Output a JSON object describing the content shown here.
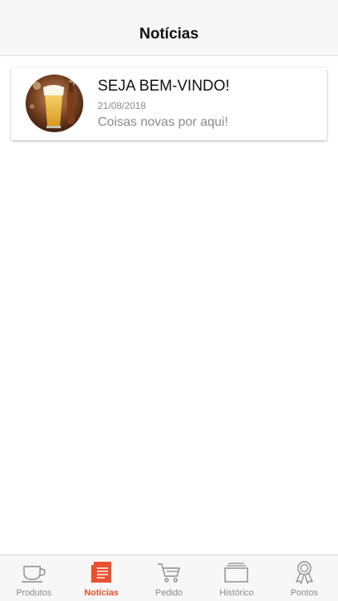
{
  "header": {
    "title": "Notícias"
  },
  "news": [
    {
      "title": "SEJA BEM-VINDO!",
      "date": "21/08/2018",
      "summary": "Coisas novas por aqui!",
      "thumbnail_icon": "beer-glass-photo"
    }
  ],
  "tabbar": {
    "items": [
      {
        "label": "Produtos",
        "icon": "coffee-cup-icon",
        "active": false
      },
      {
        "label": "Notícias",
        "icon": "newspaper-icon",
        "active": true
      },
      {
        "label": "Pedido",
        "icon": "cart-icon",
        "active": false
      },
      {
        "label": "Histórico",
        "icon": "history-icon",
        "active": false
      },
      {
        "label": "Pontos",
        "icon": "award-icon",
        "active": false
      }
    ]
  },
  "colors": {
    "accent": "#e9502f",
    "inactive": "#8a8a8a",
    "bar_background": "#f7f7f7"
  }
}
